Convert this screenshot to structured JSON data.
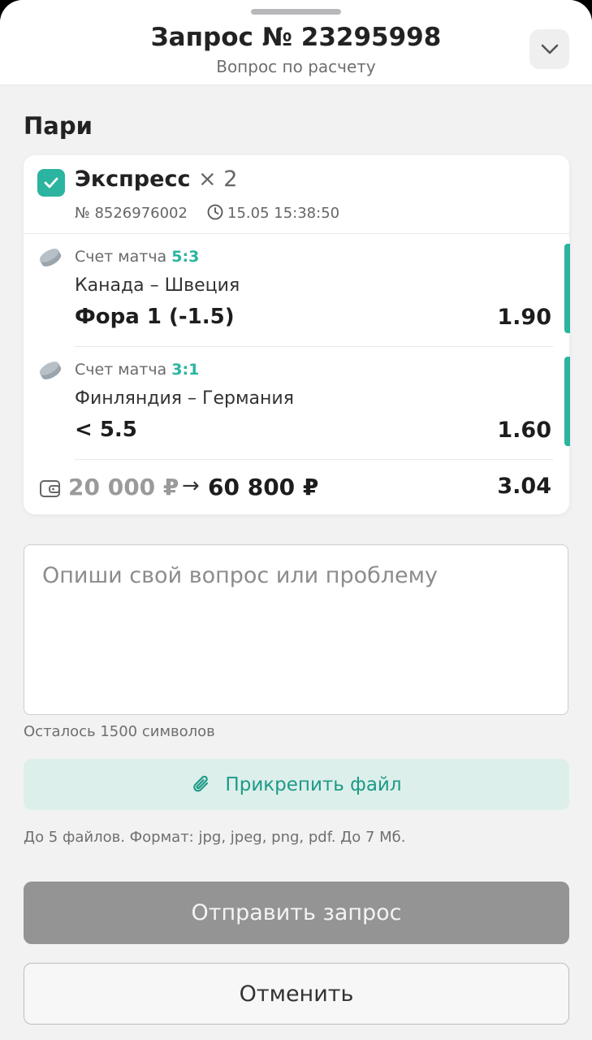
{
  "header": {
    "title": "Запрос № 23295998",
    "subtitle": "Вопрос по расчету",
    "collapse_icon": "chevron-down-icon"
  },
  "section_title": "Пари",
  "bet": {
    "type": "Экспресс",
    "multiplier": "× 2",
    "checked": true,
    "number": "№ 8526976002",
    "datetime": "15.05 15:38:50",
    "events": [
      {
        "score_label": "Счет матча",
        "score": "5:3",
        "match": "Канада – Швеция",
        "market": "Фора 1 (-1.5)",
        "odds": "1.90"
      },
      {
        "score_label": "Счет матча",
        "score": "3:1",
        "match": "Финляндия – Германия",
        "market": "< 5.5",
        "odds": "1.60"
      }
    ],
    "stake": "20 000 ₽",
    "arrow": "→",
    "payout": "60 800 ₽",
    "total_odds": "3.04"
  },
  "question": {
    "placeholder": "Опиши свой вопрос или проблему",
    "value": "",
    "counter": "Осталось 1500 символов"
  },
  "attach": {
    "label": "Прикрепить файл",
    "hint": "До 5 файлов. Формат: jpg, jpeg, png, pdf. До 7 Мб."
  },
  "actions": {
    "submit_label": "Отправить запрос",
    "cancel_label": "Отменить"
  },
  "colors": {
    "accent": "#2bb49f",
    "accent_light_bg": "#ddefeb",
    "disabled_button": "#949494"
  }
}
